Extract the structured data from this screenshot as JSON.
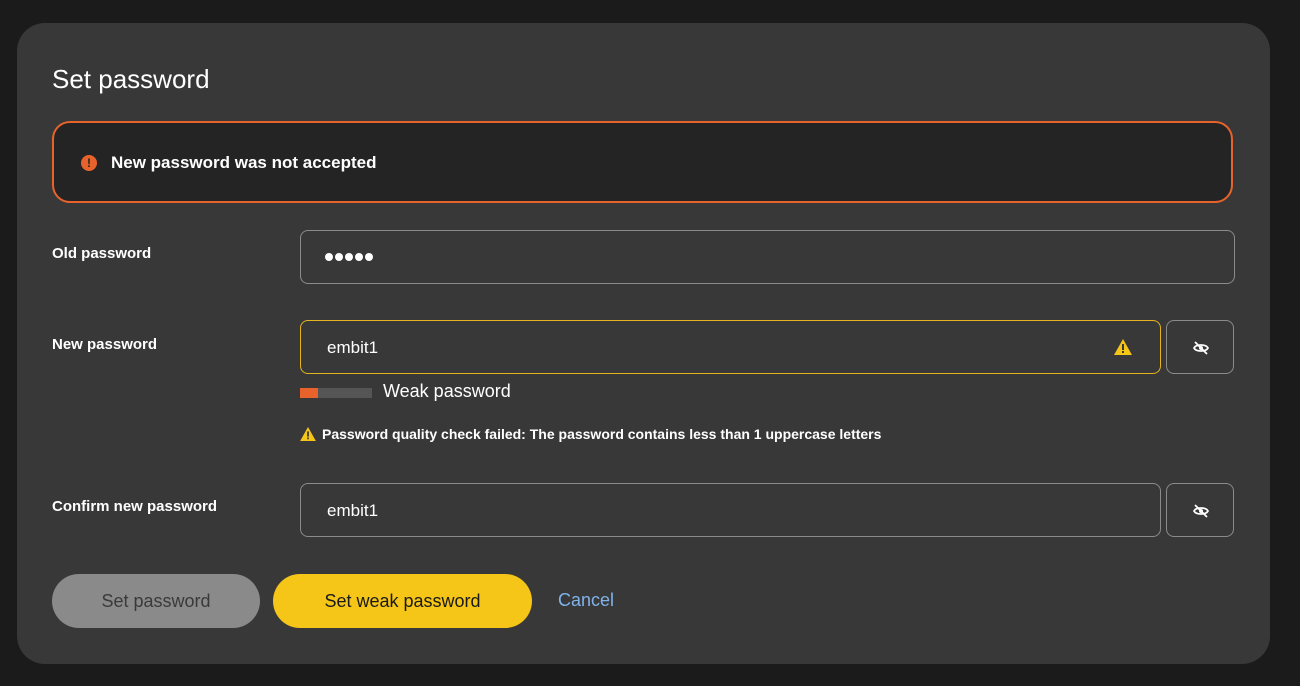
{
  "dialog": {
    "title": "Set password"
  },
  "alert": {
    "text": "New password was not accepted",
    "icon": "error-icon",
    "color": "#e8632c"
  },
  "fields": {
    "old_password": {
      "label": "Old password",
      "masked_length": 5
    },
    "new_password": {
      "label": "New password",
      "value": "embit1",
      "status_icon": "warning-icon"
    },
    "confirm_password": {
      "label": "Confirm new password",
      "value": "embit1"
    }
  },
  "strength": {
    "label": "Weak password",
    "level": 0.25,
    "color": "#e8632c"
  },
  "quality_message": "Password quality check failed: The password contains less than 1 uppercase letters",
  "buttons": {
    "set_password": "Set password",
    "set_weak_password": "Set weak password",
    "cancel": "Cancel"
  },
  "colors": {
    "accent": "#f5c518",
    "warning": "#e5b420",
    "danger": "#e8632c",
    "link": "#7fb3ea"
  }
}
